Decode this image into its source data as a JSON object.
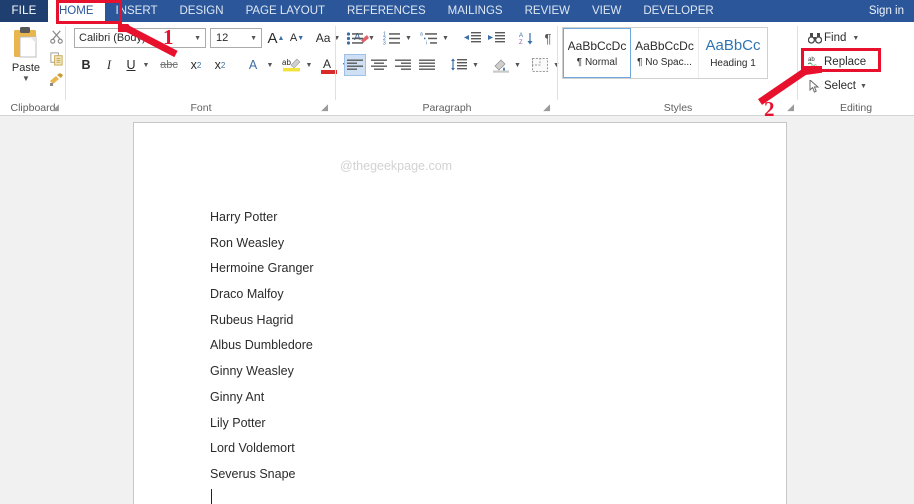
{
  "window": {
    "app": "Microsoft Word",
    "sign_in": "Sign in"
  },
  "tabs": {
    "file": "FILE",
    "items": [
      {
        "label": "HOME",
        "active": true
      },
      {
        "label": "INSERT",
        "active": false
      },
      {
        "label": "DESIGN",
        "active": false
      },
      {
        "label": "PAGE LAYOUT",
        "active": false
      },
      {
        "label": "REFERENCES",
        "active": false
      },
      {
        "label": "MAILINGS",
        "active": false
      },
      {
        "label": "REVIEW",
        "active": false
      },
      {
        "label": "VIEW",
        "active": false
      },
      {
        "label": "DEVELOPER",
        "active": false
      }
    ]
  },
  "ribbon": {
    "clipboard": {
      "group_label": "Clipboard",
      "paste_label": "Paste",
      "cut_icon": "scissors-icon",
      "copy_icon": "copy-icon",
      "format_painter_icon": "format-painter-icon"
    },
    "font": {
      "group_label": "Font",
      "font_name": "Calibri (Body)",
      "font_size": "12",
      "grow_font": "A",
      "shrink_font": "A",
      "change_case": "Aa",
      "clear_formatting_icon": "clear-formatting-icon",
      "bold": "B",
      "italic": "I",
      "underline": "U",
      "strikethrough": "abc",
      "subscript": "x",
      "superscript": "x",
      "text_effects": "A",
      "highlight": "ab",
      "font_color": "A"
    },
    "paragraph": {
      "group_label": "Paragraph",
      "bullets_icon": "bullet-list-icon",
      "numbering_icon": "numbered-list-icon",
      "multilevel_icon": "multilevel-list-icon",
      "decrease_indent_icon": "decrease-indent-icon",
      "increase_indent_icon": "increase-indent-icon",
      "sort_icon": "sort-icon",
      "show_marks_icon": "paragraph-mark-icon",
      "align_left_icon": "align-left-icon",
      "align_center_icon": "align-center-icon",
      "align_right_icon": "align-right-icon",
      "justify_icon": "justify-icon",
      "line_spacing_icon": "line-spacing-icon",
      "shading_icon": "shading-icon",
      "borders_icon": "borders-icon"
    },
    "styles": {
      "group_label": "Styles",
      "items": [
        {
          "preview": "AaBbCcDc",
          "name": "¶ Normal",
          "selected": true
        },
        {
          "preview": "AaBbCcDc",
          "name": "¶ No Spac...",
          "selected": false
        },
        {
          "preview": "AaBbCc",
          "name": "Heading 1",
          "selected": false
        }
      ]
    },
    "editing": {
      "group_label": "Editing",
      "find": "Find",
      "replace": "Replace",
      "select": "Select",
      "find_icon": "binoculars-icon",
      "replace_icon": "replace-icon",
      "select_icon": "cursor-select-icon"
    }
  },
  "document": {
    "watermark": "@thegeekpage.com",
    "lines": [
      "Harry Potter",
      "Ron Weasley",
      "Hermoine Granger",
      "Draco Malfoy",
      "Rubeus Hagrid",
      "Albus Dumbledore",
      "Ginny Weasley",
      "Ginny Ant",
      "Lily Potter",
      "Lord Voldemort",
      "Severus Snape"
    ]
  },
  "annotations": {
    "step1": "1",
    "step2": "2",
    "color": "#e8112d"
  }
}
